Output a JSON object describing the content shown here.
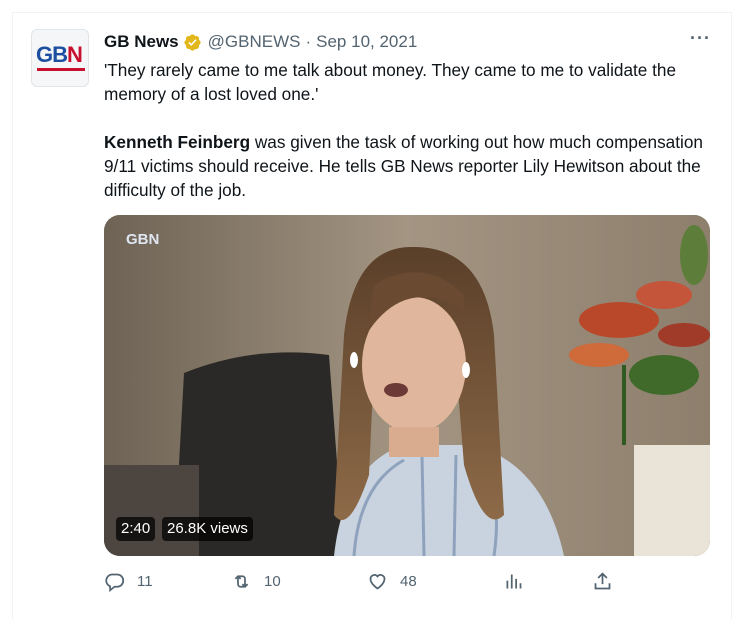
{
  "account": {
    "avatar_text_1": "GB",
    "avatar_text_2": "N",
    "name": "GB News",
    "handle": "@GBNEWS",
    "separator": "·",
    "date": "Sep 10, 2021"
  },
  "tweet": {
    "line1": "'They rarely came to me talk about money. They came to me to validate the memory of a lost loved one.'",
    "bold_name": "Kenneth Feinberg",
    "line2_rest": " was given the task of working out how much compensation 9/11 victims should receive. He tells GB News reporter Lily Hewitson about the difficulty of the job."
  },
  "video": {
    "watermark": "GBN",
    "duration": "2:40",
    "views": "26.8K views"
  },
  "actions": {
    "reply_count": "11",
    "retweet_count": "10",
    "like_count": "48"
  },
  "colors": {
    "verified": "#e2b719",
    "muted": "#536471",
    "brand_blue": "#1d4fa0",
    "brand_red": "#c8102e"
  }
}
